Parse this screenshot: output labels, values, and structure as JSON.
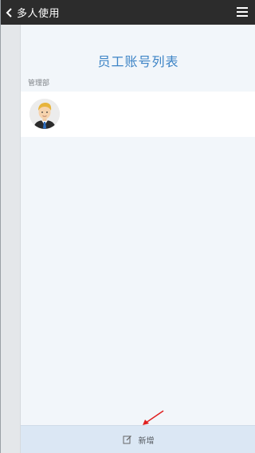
{
  "header": {
    "back_icon": "chevron-left-icon",
    "title": "多人使用",
    "menu_icon": "hamburger-menu-icon"
  },
  "main": {
    "page_title": "员工账号列表",
    "section_label": "管理部",
    "employees": [
      {
        "avatar_icon": "male-employee-avatar"
      }
    ]
  },
  "footer": {
    "add_icon": "edit-icon",
    "add_label": "新增"
  },
  "annotation": {
    "arrow_icon": "red-arrow-icon",
    "arrow_color": "#e02020"
  },
  "colors": {
    "topbar_bg": "#2c2c2c",
    "title_blue": "#3d84c6",
    "content_bg": "#f2f6fa",
    "footer_bg": "#dbe7f4"
  }
}
